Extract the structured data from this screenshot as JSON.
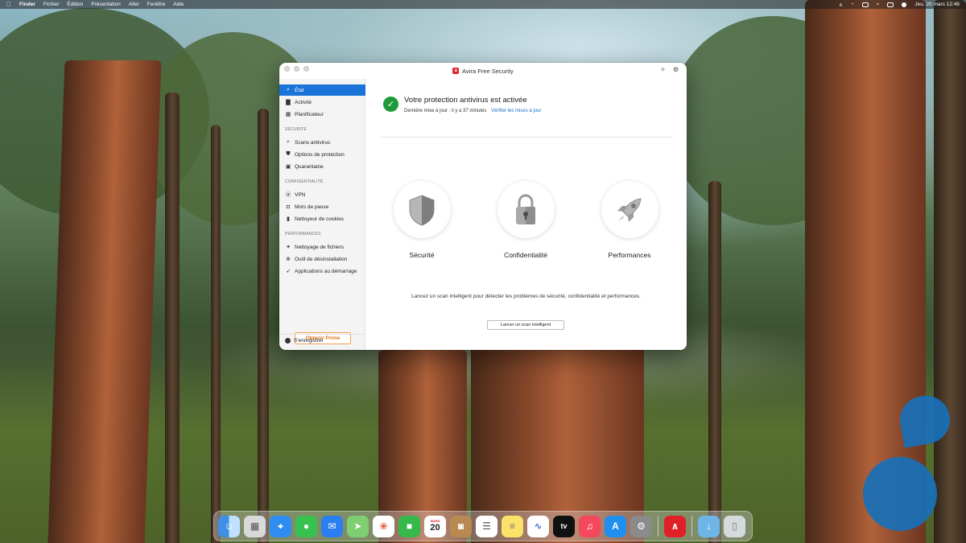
{
  "menubar": {
    "app": "Finder",
    "items": [
      "Fichier",
      "Édition",
      "Présentation",
      "Aller",
      "Fenêtre",
      "Aide"
    ],
    "clock": "Jeu. 20 mars  12:46"
  },
  "window": {
    "title": "Avira Free Security",
    "logo_letter": "a"
  },
  "sidebar": {
    "items_top": [
      {
        "label": "État",
        "icon": "magnifier-icon"
      },
      {
        "label": "Activité",
        "icon": "bar-chart-icon"
      },
      {
        "label": "Planificateur",
        "icon": "calendar-icon"
      }
    ],
    "section_security": "SÉCURITÉ",
    "items_security": [
      {
        "label": "Scans antivirus",
        "icon": "magnifier-icon"
      },
      {
        "label": "Options de protection",
        "icon": "shield-icon"
      },
      {
        "label": "Quarantaine",
        "icon": "quarantine-icon"
      }
    ],
    "section_privacy": "CONFIDENTIALITÉ",
    "items_privacy": [
      {
        "label": "VPN",
        "icon": "vpn-icon"
      },
      {
        "label": "Mots de passe",
        "icon": "lock-icon"
      },
      {
        "label": "Nettoyeur de cookies",
        "icon": "trash-icon"
      }
    ],
    "section_performance": "PERFORMANCES",
    "items_performance": [
      {
        "label": "Nettoyage de fichiers",
        "icon": "broom-icon"
      },
      {
        "label": "Outil de désinstallation",
        "icon": "uninstall-icon"
      },
      {
        "label": "Applications au démarrage",
        "icon": "rocket-icon"
      }
    ],
    "prime_button": "Obtenir Prime",
    "register": "S'enregistrer"
  },
  "main": {
    "status_title": "Votre protection antivirus est activée",
    "status_sub": "Dernière mise à jour : il y a 37 minutes",
    "update_link": "Vérifier les mises à jour",
    "features": [
      {
        "label": "Sécurité",
        "icon": "shield-icon"
      },
      {
        "label": "Confidentialité",
        "icon": "padlock-icon"
      },
      {
        "label": "Performances",
        "icon": "rocket-icon"
      }
    ],
    "hint": "Lancez un scan intelligent pour détecter les problèmes de sécurité, confidentialité et performances.",
    "scan_button": "Lancer un scan intelligent"
  },
  "dock": {
    "calendar_month": "MARS",
    "calendar_day": "20",
    "tv_label": "tv",
    "apps": [
      "finder",
      "launchpad",
      "safari",
      "messages",
      "mail",
      "maps",
      "photos",
      "facetime",
      "calendar",
      "contacts",
      "reminders",
      "notes",
      "freeform",
      "tv",
      "music",
      "app-store",
      "system-settings",
      "avira",
      "downloads",
      "trash"
    ]
  },
  "colors": {
    "accent": "#1a73d9",
    "success": "#1f9a3a",
    "prime": "#e0781f",
    "avira_red": "#e02027"
  }
}
